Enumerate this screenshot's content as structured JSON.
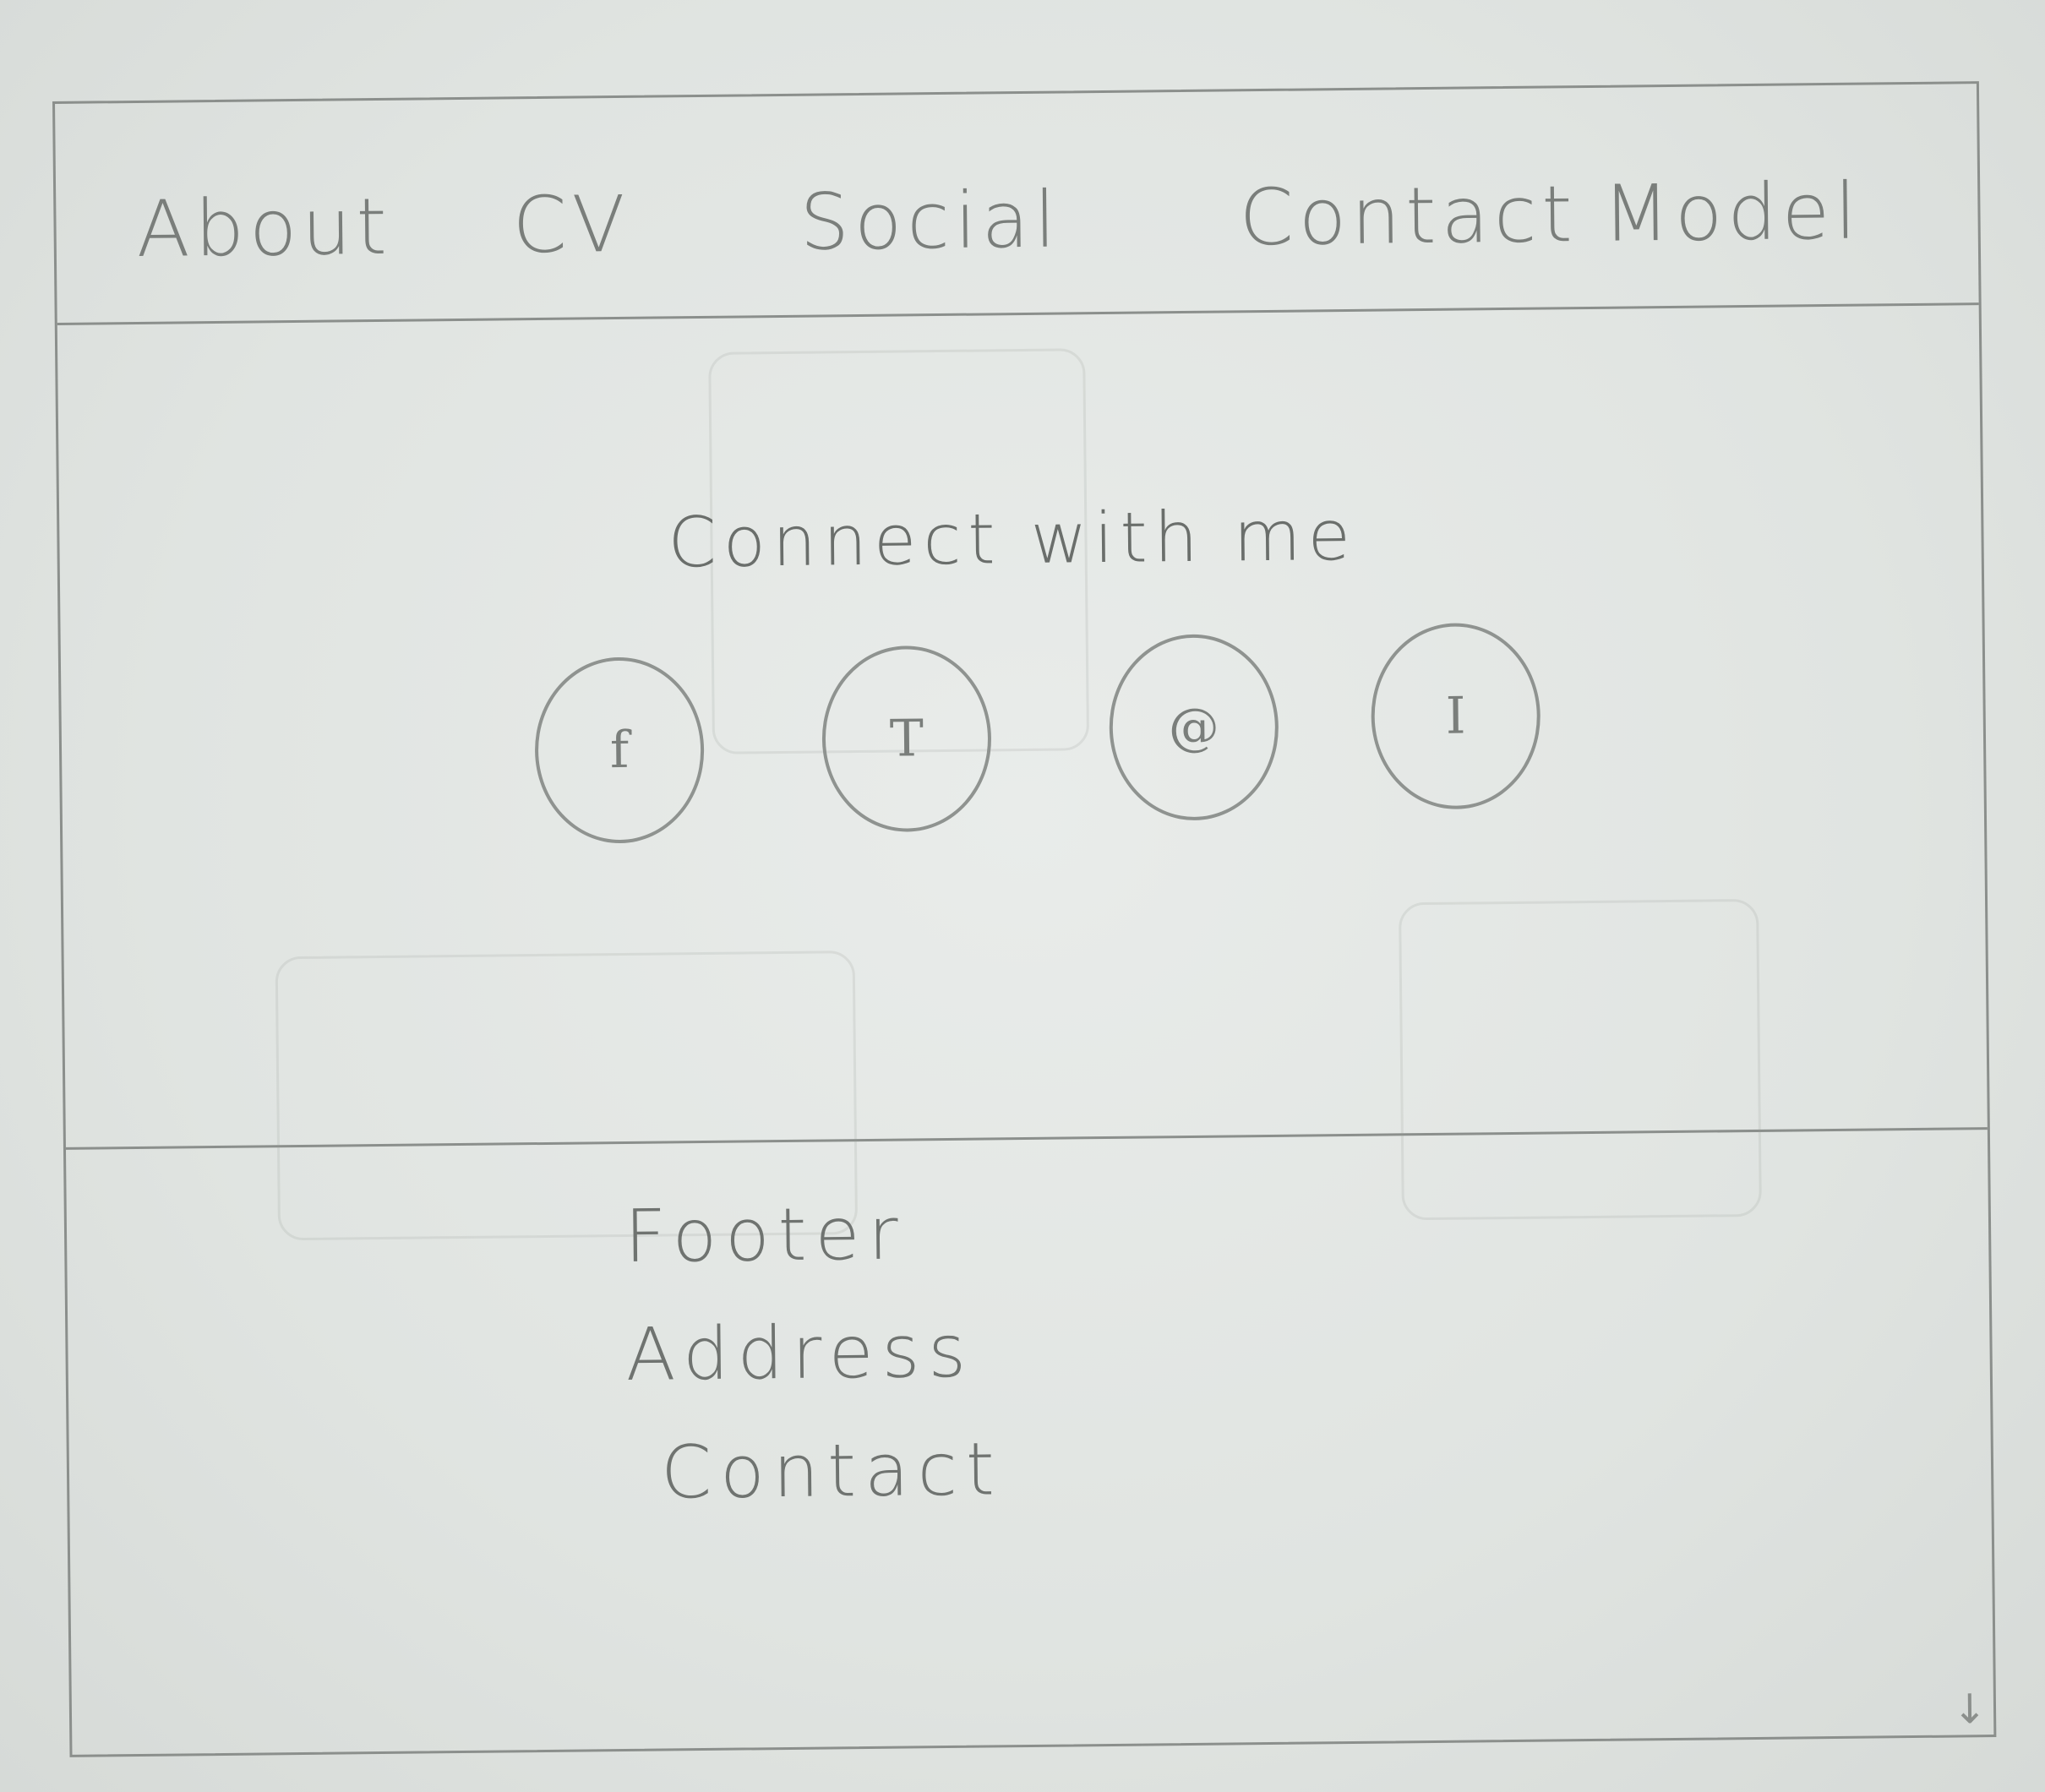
{
  "nav": {
    "items": [
      {
        "label": "About"
      },
      {
        "label": "CV"
      },
      {
        "label": "Social"
      },
      {
        "label": "Contact"
      },
      {
        "label": "Model"
      }
    ]
  },
  "main": {
    "heading": "Connect with me",
    "social": [
      {
        "glyph": "f",
        "icon": "facebook-icon"
      },
      {
        "glyph": "T",
        "icon": "twitter-icon"
      },
      {
        "glyph": "@",
        "icon": "email-icon"
      },
      {
        "glyph": "I",
        "icon": "instagram-icon"
      }
    ]
  },
  "footer": {
    "title": "Footer",
    "address_label": "Address",
    "contact_label": "Contact"
  }
}
